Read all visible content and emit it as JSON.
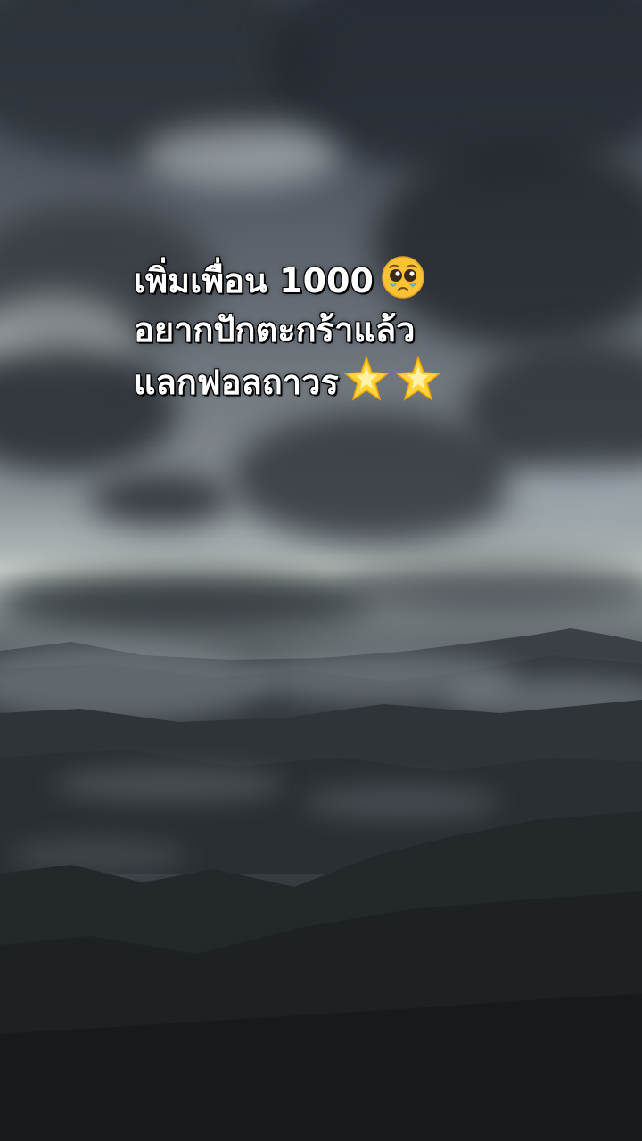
{
  "caption": {
    "line1": "เพิ่มเพื่อน 1000",
    "line2": "อยากปักตะกร้าแล้ว",
    "line3": "แลกฟอลถาวร"
  },
  "icons": {
    "face": "pleading-face-emoji",
    "stars": [
      "glowing-star-emoji",
      "glowing-star-emoji"
    ]
  },
  "colors": {
    "caption_text": "#ffffff",
    "caption_outline": "#000000",
    "sky_dark": "#3d434b",
    "horizon_light": "#c5ccc8",
    "forest_dark": "#191c1f"
  }
}
